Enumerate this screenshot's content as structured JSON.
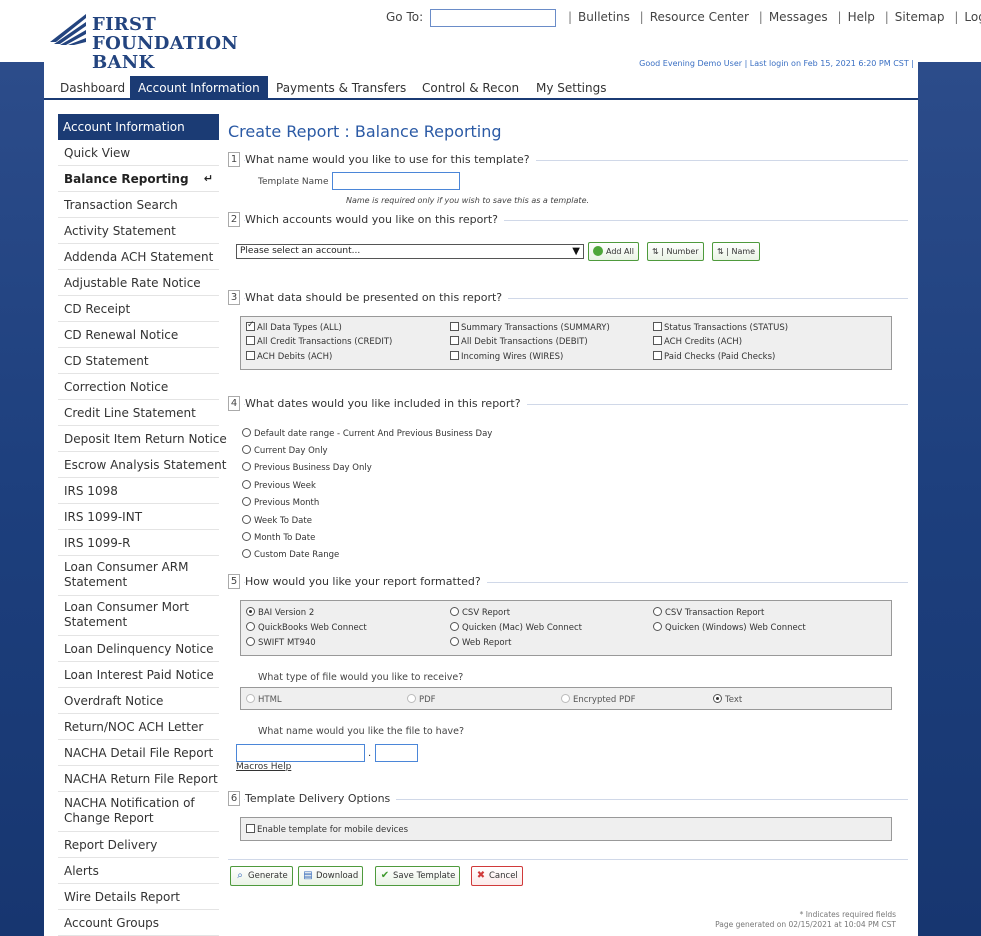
{
  "brand": {
    "name_line1": "FIRST FOUNDATION",
    "name_line2": "BANK",
    "color": "#23447f"
  },
  "header": {
    "goto_label": "Go To:",
    "links": [
      "Bulletins",
      "Resource Center",
      "Messages",
      "Help",
      "Sitemap",
      "Log Off"
    ],
    "greeting": "Good Evening Demo User | Last login on Feb 15, 2021 6:20 PM CST |"
  },
  "nav": {
    "tabs": [
      "Dashboard",
      "Account Information",
      "Payments & Transfers",
      "Control & Recon",
      "My Settings"
    ],
    "active": "Account Information"
  },
  "sidebar": {
    "heading": "Account Information",
    "items": [
      "Quick View",
      "Balance Reporting",
      "Transaction Search",
      "Activity Statement",
      "Addenda ACH Statement",
      "Adjustable Rate Notice",
      "CD Receipt",
      "CD Renewal Notice",
      "CD Statement",
      "Correction Notice",
      "Credit Line Statement",
      "Deposit Item Return Notice",
      "Escrow Analysis Statement",
      "IRS 1098",
      "IRS 1099-INT",
      "IRS 1099-R",
      "Loan Consumer ARM Statement",
      "Loan Consumer Mort Statement",
      "Loan Delinquency Notice",
      "Loan Interest Paid Notice",
      "Overdraft Notice",
      "Return/NOC ACH Letter",
      "NACHA Detail File Report",
      "NACHA Return File Report",
      "NACHA Notification of Change Report",
      "Report Delivery",
      "Alerts",
      "Wire Details Report",
      "Account Groups"
    ],
    "active_index": 1
  },
  "main": {
    "title": "Create Report : Balance Reporting",
    "s1": {
      "num": "1",
      "q": "What name would you like to use for this template?",
      "label": "Template Name",
      "value": "",
      "note": "Name is required only if you wish to save this as a template."
    },
    "s2": {
      "num": "2",
      "q": "Which accounts would you like on this report?",
      "select": "Please select an account...",
      "add_all": "Add All",
      "sort_number": "Number",
      "sort_name": "Name"
    },
    "s3": {
      "num": "3",
      "q": "What data should be presented on this report?",
      "options": [
        {
          "label": "All Data Types (ALL)",
          "checked": true
        },
        {
          "label": "Summary Transactions (SUMMARY)",
          "checked": false
        },
        {
          "label": "Status Transactions (STATUS)",
          "checked": false
        },
        {
          "label": "All Credit Transactions (CREDIT)",
          "checked": false
        },
        {
          "label": "All Debit Transactions (DEBIT)",
          "checked": false
        },
        {
          "label": "ACH Credits (ACH)",
          "checked": false
        },
        {
          "label": "ACH Debits (ACH)",
          "checked": false
        },
        {
          "label": "Incoming Wires (WIRES)",
          "checked": false
        },
        {
          "label": "Paid Checks (Paid Checks)",
          "checked": false
        }
      ]
    },
    "s4": {
      "num": "4",
      "q": "What dates would you like included in this report?",
      "options": [
        "Default date range - Current And Previous Business Day",
        "Current Day Only",
        "Previous Business Day Only",
        "Previous Week",
        "Previous Month",
        "Week To Date",
        "Month To Date",
        "Custom Date Range"
      ]
    },
    "s5": {
      "num": "5",
      "q": "How would you like your report formatted?",
      "formats": [
        {
          "label": "BAI Version 2",
          "selected": true
        },
        {
          "label": "CSV Report",
          "selected": false
        },
        {
          "label": "CSV Transaction Report",
          "selected": false
        },
        {
          "label": "QuickBooks Web Connect",
          "selected": false
        },
        {
          "label": "Quicken (Mac) Web Connect",
          "selected": false
        },
        {
          "label": "Quicken (Windows) Web Connect",
          "selected": false
        },
        {
          "label": "SWIFT MT940",
          "selected": false
        },
        {
          "label": "Web Report",
          "selected": false
        }
      ],
      "filetype_q": "What type of file would you like to receive?",
      "filetypes": [
        {
          "label": "HTML",
          "selected": false
        },
        {
          "label": "PDF",
          "selected": false
        },
        {
          "label": "Encrypted PDF",
          "selected": false
        },
        {
          "label": "Text",
          "selected": true
        }
      ],
      "filename_q": "What name would you like the file to have?",
      "dot": ".",
      "macros": "Macros Help"
    },
    "s6": {
      "num": "6",
      "q": "Template Delivery Options",
      "option": "Enable template for mobile devices"
    },
    "actions": {
      "generate": "Generate",
      "download": "Download",
      "save": "Save Template",
      "cancel": "Cancel"
    },
    "footer": {
      "required": "* Indicates required fields",
      "generated": "Page generated on 02/15/2021 at 10:04 PM CST"
    }
  }
}
